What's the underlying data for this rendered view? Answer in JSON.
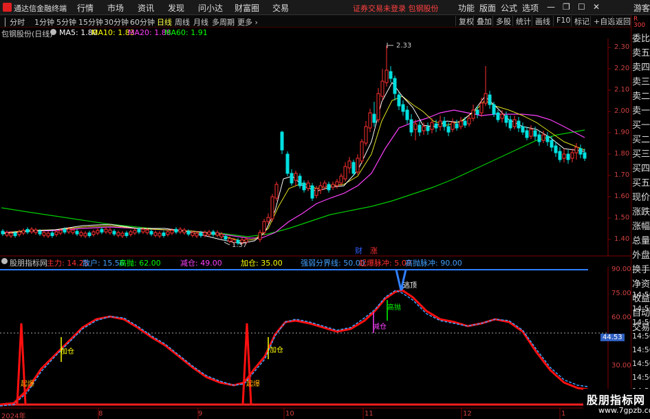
{
  "menubar": {
    "app_title": "通达信金融终端",
    "items": [
      "行情",
      "市场",
      "资讯",
      "发现",
      "问小达",
      "财富圈",
      "交易"
    ],
    "login_warning": "证券交易未登录  包钢股份",
    "right_items": [
      "功能",
      "版面",
      "公式",
      "选项"
    ],
    "guest": "游客"
  },
  "periods": {
    "items": [
      "分时",
      "1分钟",
      "5分钟",
      "15分钟",
      "30分钟",
      "60分钟",
      "日线",
      "周线",
      "月线",
      "多周期",
      "更多"
    ],
    "active": "日线"
  },
  "toolbar": [
    "复权",
    "叠加",
    "多股",
    "统计",
    "画线",
    "F10",
    "标记",
    "+自选",
    "返回"
  ],
  "stock": {
    "name": "包钢股份(日线)",
    "ma5_label": "MA5: 1.80",
    "ma10_label": "MA10: 1.83",
    "ma20_label": "MA20: 1.88",
    "ma60_label": "MA60: 1.91",
    "high_marker": "2.33",
    "low_marker": "1.37",
    "badge_cai": "财",
    "badge_zhang": "涨"
  },
  "price_axis": [
    "2.30",
    "2.20",
    "2.10",
    "2.00",
    "1.90",
    "1.80",
    "1.70",
    "1.60",
    "1.50",
    "1.40"
  ],
  "right_panel": [
    "委比",
    "卖五",
    "卖四",
    "卖三",
    "卖二",
    "卖一",
    "买一",
    "买二",
    "买三",
    "买四",
    "买五",
    "现价",
    "涨跌",
    "涨幅",
    "总量",
    "外盘",
    "换手",
    "净资",
    "收益",
    "自动",
    "交易"
  ],
  "right_times": [
    "14:56",
    "14:56",
    "14:56",
    "14:56",
    "14:56",
    "14:56",
    "14:56",
    "14:56"
  ],
  "r_badge": "R",
  "r_badge_sub": "300",
  "indicator": {
    "name": "股朋指标网",
    "zhuli": "主力: 14.25",
    "sanhu": "散户: 15.56",
    "gaopao": "高抛: 62.00",
    "jiancang": "减仓: 49.00",
    "jiacang": "加仓: 35.00",
    "qiangruo": "强弱分界线: 50.00",
    "qibao": "起爆脉冲: 5.00",
    "gaopao_pulse": "高抛脉冲: 90.00",
    "axis": [
      "90.00",
      "75.00",
      "60.00",
      "45.00",
      "30.00"
    ],
    "current_value": "44.53",
    "annotations": {
      "jiacang1": "加仓",
      "jiacang2": "加仓",
      "qibao1": "起爆",
      "qibao2": "起爆",
      "jiancang": "减仓",
      "gaopao": "高抛",
      "taoding": "逃顶"
    }
  },
  "time_axis": [
    "2024年",
    "8",
    "9",
    "10",
    "11",
    "12",
    "1"
  ],
  "watermark": {
    "main": "股朋指标网",
    "sub": "www.7gpzb.com"
  },
  "colors": {
    "up": "#ff3030",
    "down": "#00e0e0",
    "ma5": "#ffffff",
    "ma10": "#ffff00",
    "ma20": "#ff40ff",
    "ma60": "#00ff00"
  }
}
